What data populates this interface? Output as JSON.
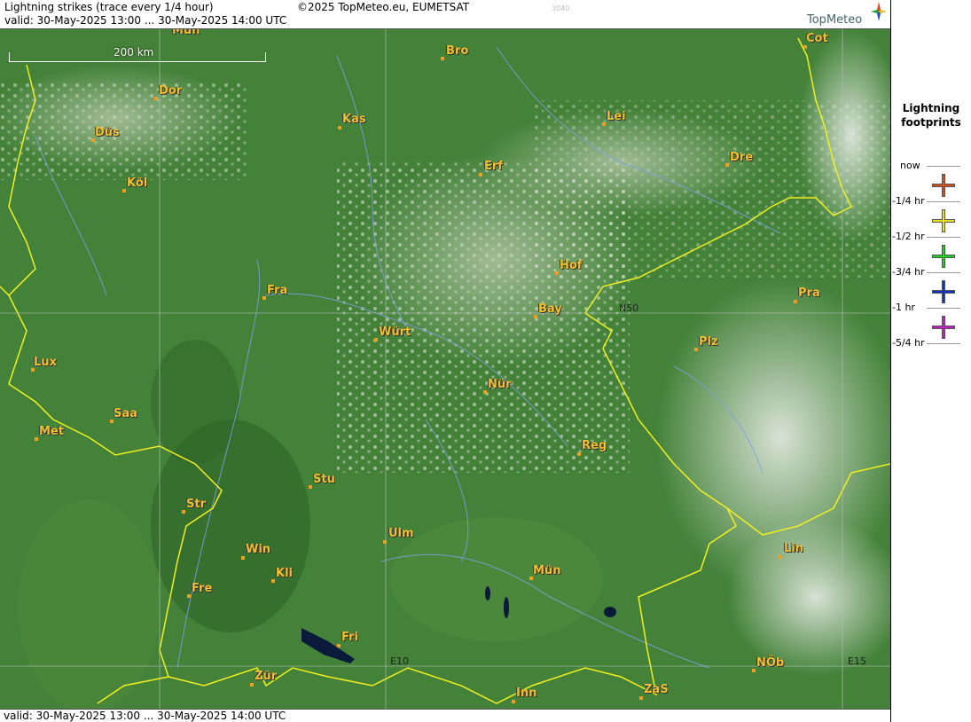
{
  "header": {
    "title": "Lightning strikes (trace every 1/4 hour)",
    "copyright": "©2025 TopMeteo.eu, EUMETSAT",
    "code": "3040",
    "valid": "valid:  30-May-2025 13:00 ... 30-May-2025 14:00 UTC",
    "logo": "TopMeteo"
  },
  "footer": {
    "valid": "valid:  30-May-2025 13:00 ... 30-May-2025 14:00 UTC"
  },
  "legend": {
    "title_line1": "Lightning",
    "title_line2": "footprints",
    "items": [
      {
        "label": "now",
        "color": "#d4501a"
      },
      {
        "label": "-1/4 hr",
        "color": "#e8e020"
      },
      {
        "label": "-1/2 hr",
        "color": "#20d020"
      },
      {
        "label": "-3/4 hr",
        "color": "#1030c0"
      },
      {
        "label": "-1 hr",
        "color": "#c020c0"
      },
      {
        "label": "-5/4 hr",
        "color": ""
      }
    ]
  },
  "map": {
    "scale_label": "200 km",
    "grid_labels": [
      "N50",
      "E10",
      "E15"
    ],
    "cities": [
      {
        "name": "Mün"
      },
      {
        "name": "Bro"
      },
      {
        "name": "Cot"
      },
      {
        "name": "Dor"
      },
      {
        "name": "Kas"
      },
      {
        "name": "Lei"
      },
      {
        "name": "Düs"
      },
      {
        "name": "Dre"
      },
      {
        "name": "Erf"
      },
      {
        "name": "Köl"
      },
      {
        "name": "Hof"
      },
      {
        "name": "Fra"
      },
      {
        "name": "Pra"
      },
      {
        "name": "Bay"
      },
      {
        "name": "Würt"
      },
      {
        "name": "Plz"
      },
      {
        "name": "Lux"
      },
      {
        "name": "Nür"
      },
      {
        "name": "Saa"
      },
      {
        "name": "Met"
      },
      {
        "name": "Reg"
      },
      {
        "name": "Stu"
      },
      {
        "name": "Str"
      },
      {
        "name": "Ulm"
      },
      {
        "name": "Lin"
      },
      {
        "name": "Win"
      },
      {
        "name": "Mün"
      },
      {
        "name": "Kli"
      },
      {
        "name": "Fre"
      },
      {
        "name": "Fri"
      },
      {
        "name": "NÖb"
      },
      {
        "name": "Zür"
      },
      {
        "name": "ZaS"
      },
      {
        "name": "Inn"
      }
    ]
  }
}
